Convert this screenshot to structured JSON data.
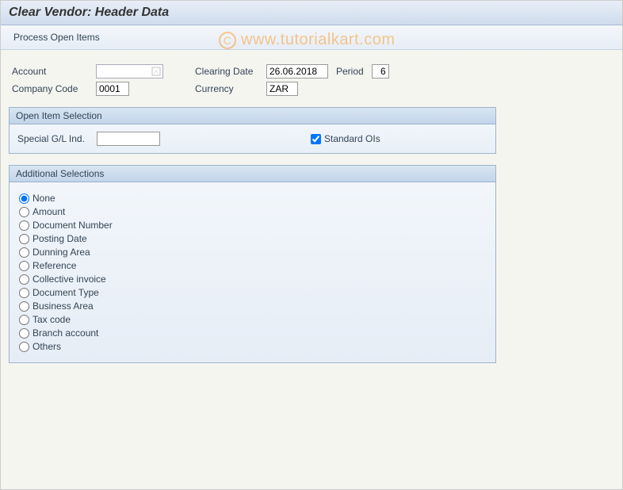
{
  "header": {
    "title": "Clear Vendor: Header Data"
  },
  "toolbar": {
    "process_open_items": "Process Open Items"
  },
  "fields": {
    "account_label": "Account",
    "account_value": "",
    "company_code_label": "Company Code",
    "company_code_value": "0001",
    "clearing_date_label": "Clearing Date",
    "clearing_date_value": "26.06.2018",
    "period_label": "Period",
    "period_value": "6",
    "currency_label": "Currency",
    "currency_value": "ZAR"
  },
  "open_item_selection": {
    "title": "Open Item Selection",
    "special_gl_label": "Special G/L Ind.",
    "special_gl_value": "",
    "standard_ois_label": "Standard OIs",
    "standard_ois_checked": true
  },
  "additional_selections": {
    "title": "Additional Selections",
    "selected": "None",
    "options": [
      "None",
      "Amount",
      "Document Number",
      "Posting Date",
      "Dunning Area",
      "Reference",
      "Collective invoice",
      "Document Type",
      "Business Area",
      "Tax code",
      "Branch account",
      "Others"
    ]
  },
  "watermark": "www.tutorialkart.com"
}
